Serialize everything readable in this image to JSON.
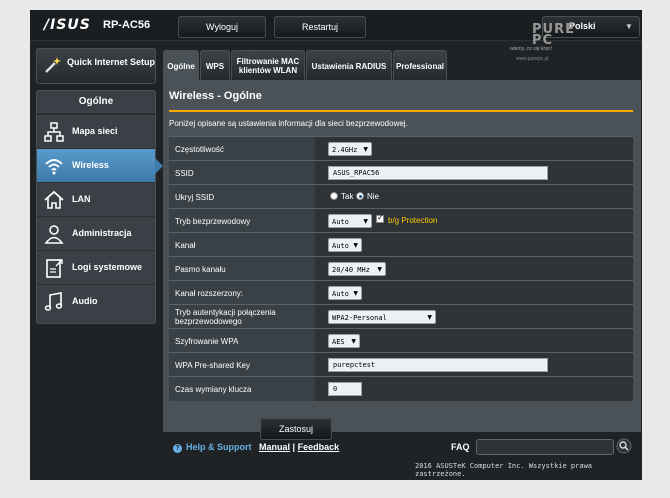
{
  "header": {
    "brand": "/ISUS",
    "model": "RP-AC56",
    "logout_label": "Wyloguj",
    "restart_label": "Restartuj",
    "language": "Polski"
  },
  "watermark": {
    "tagline": "wiemy, co się kręci",
    "url": "www.purepc.pl"
  },
  "sidebar": {
    "quick_setup_label": "Quick Internet Setup",
    "section_title": "Ogólne",
    "items": [
      {
        "label": "Mapa sieci",
        "icon": "network-map-icon",
        "active": false
      },
      {
        "label": "Wireless",
        "icon": "wireless-icon",
        "active": true
      },
      {
        "label": "LAN",
        "icon": "home-icon",
        "active": false
      },
      {
        "label": "Administracja",
        "icon": "user-icon",
        "active": false
      },
      {
        "label": "Logi systemowe",
        "icon": "log-icon",
        "active": false
      },
      {
        "label": "Audio",
        "icon": "music-icon",
        "active": false
      }
    ]
  },
  "tabs": [
    {
      "label": "Ogólne",
      "active": true
    },
    {
      "label": "WPS",
      "active": false
    },
    {
      "label": "Filtrowanie MAC klientów WLAN",
      "active": false
    },
    {
      "label": "Ustawienia RADIUS",
      "active": false
    },
    {
      "label": "Professional",
      "active": false
    }
  ],
  "main": {
    "title": "Wireless - Ogólne",
    "description": "Poniżej opisane są ustawienia informacji dla sieci bezprzewodowej.",
    "accent_color": "#ffa800",
    "fields": {
      "frequency": {
        "label": "Częstotliwość",
        "value": "2.4GHz"
      },
      "ssid": {
        "label": "SSID",
        "value": "ASUS_RPAC56"
      },
      "hide_ssid": {
        "label": "Ukryj SSID",
        "yes_label": "Tak",
        "no_label": "Nie",
        "selected": "Nie"
      },
      "wireless_mode": {
        "label": "Tryb bezprzewodowy",
        "value": "Auto",
        "bg_protection_label": "b/g Protection",
        "bg_protection_checked": true
      },
      "channel": {
        "label": "Kanał",
        "value": "Auto"
      },
      "bandwidth": {
        "label": "Pasmo kanału",
        "value": "20/40 MHz"
      },
      "ext_channel": {
        "label": "Kanał rozszerzony:",
        "value": "Auto"
      },
      "auth_method": {
        "label": "Tryb autentykacji połączenia bezprzewodowego",
        "value": "WPA2-Personal"
      },
      "wpa_encryption": {
        "label": "Szyfrowanie WPA",
        "value": "AES"
      },
      "wpa_psk": {
        "label": "WPA Pre-shared Key",
        "value": "purepctest"
      },
      "key_rotation": {
        "label": "Czas wymiany klucza",
        "value": "0"
      }
    },
    "apply_label": "Zastosuj"
  },
  "footer": {
    "help_label": "Help & Support",
    "manual_label": "Manual",
    "separator": "|",
    "feedback_label": "Feedback",
    "faq_label": "FAQ",
    "copyright": "2016 ASUSTeK Computer Inc. Wszystkie prawa zastrzeżone."
  }
}
